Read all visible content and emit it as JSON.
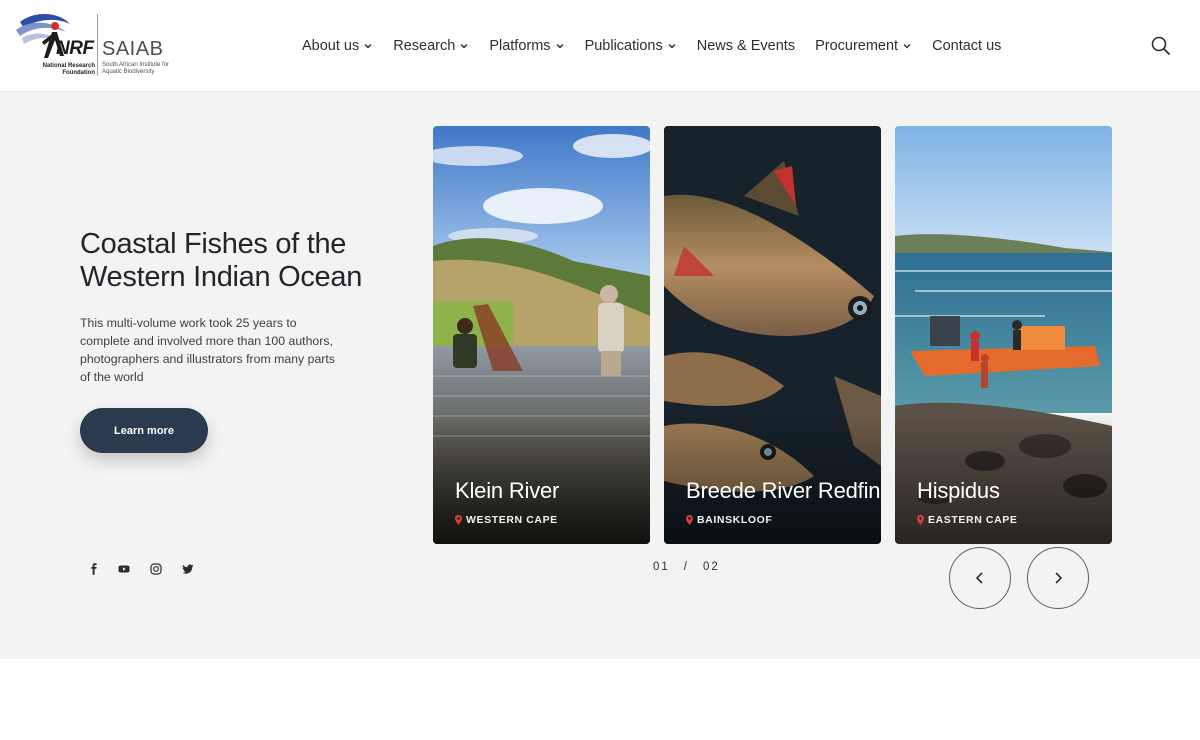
{
  "header": {
    "logo": {
      "nrf_text": "NRF",
      "nrf_sub": "National Research Foundation",
      "saiab_text": "SAIAB",
      "saiab_sub": "South African Institute for Aquatic Biodiversity"
    },
    "nav": [
      {
        "label": "About us",
        "has_dropdown": true
      },
      {
        "label": "Research",
        "has_dropdown": true
      },
      {
        "label": "Platforms",
        "has_dropdown": true
      },
      {
        "label": "Publications",
        "has_dropdown": true
      },
      {
        "label": "News & Events",
        "has_dropdown": false
      },
      {
        "label": "Procurement",
        "has_dropdown": true
      },
      {
        "label": "Contact us",
        "has_dropdown": false
      }
    ],
    "search_icon": "search-icon"
  },
  "hero": {
    "title": "Coastal Fishes of the Western Indian Ocean",
    "description": "This multi-volume work took 25 years to complete and involved more than 100 authors, photographers and illustrators from many parts of the world",
    "button_label": "Learn more",
    "social": [
      "facebook-icon",
      "youtube-icon",
      "instagram-icon",
      "twitter-icon"
    ]
  },
  "slides": [
    {
      "title": "Klein River",
      "location": "WESTERN CAPE"
    },
    {
      "title": "Breede River Redfins",
      "location": "BAINSKLOOF"
    },
    {
      "title": "Hispidus",
      "location": "EASTERN CAPE"
    }
  ],
  "pager": {
    "current": "01",
    "separator": "/",
    "total": "02"
  },
  "colors": {
    "button": "#2c3a4f",
    "hero_bg": "#f3f3f3",
    "pin": "#e03a3a",
    "nrf_red": "#d92b2b",
    "nrf_blue": "#2d4fa3"
  }
}
